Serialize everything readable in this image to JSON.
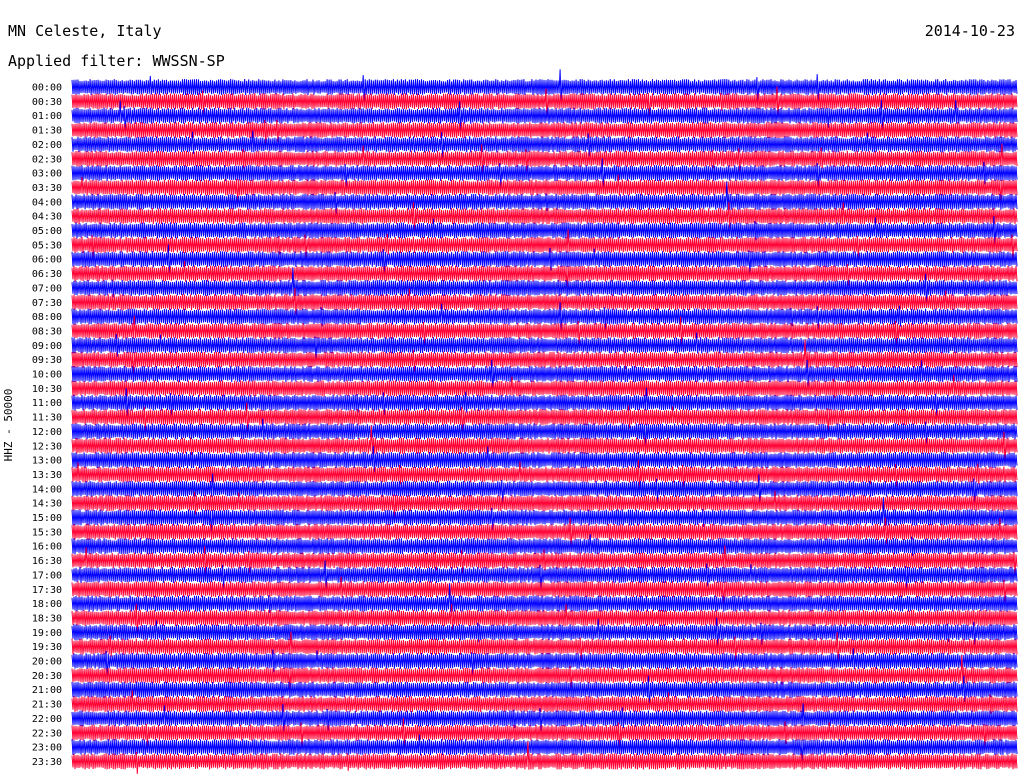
{
  "header": {
    "station": "MN Celeste, Italy",
    "filter": "Applied filter: WWSSN-SP",
    "date": "2014-10-23"
  },
  "chart_data": {
    "type": "line",
    "subtype": "helicorder",
    "ylabel": "HHZ - 50000",
    "row_labels": [
      "00:00",
      "00:30",
      "01:00",
      "01:30",
      "02:00",
      "02:30",
      "03:00",
      "03:30",
      "04:00",
      "04:30",
      "05:00",
      "05:30",
      "06:00",
      "06:30",
      "07:00",
      "07:30",
      "08:00",
      "08:30",
      "09:00",
      "09:30",
      "10:00",
      "10:30",
      "11:00",
      "11:30",
      "12:00",
      "12:30",
      "13:00",
      "13:30",
      "14:00",
      "14:30",
      "15:00",
      "15:30",
      "16:00",
      "16:30",
      "17:00",
      "17:30",
      "18:00",
      "18:30",
      "19:00",
      "19:30",
      "20:00",
      "20:30",
      "21:00",
      "21:30",
      "22:00",
      "22:30",
      "23:00",
      "23:30"
    ],
    "trace_colors": [
      "#0000ff",
      "#ff0033"
    ],
    "grid": false
  }
}
